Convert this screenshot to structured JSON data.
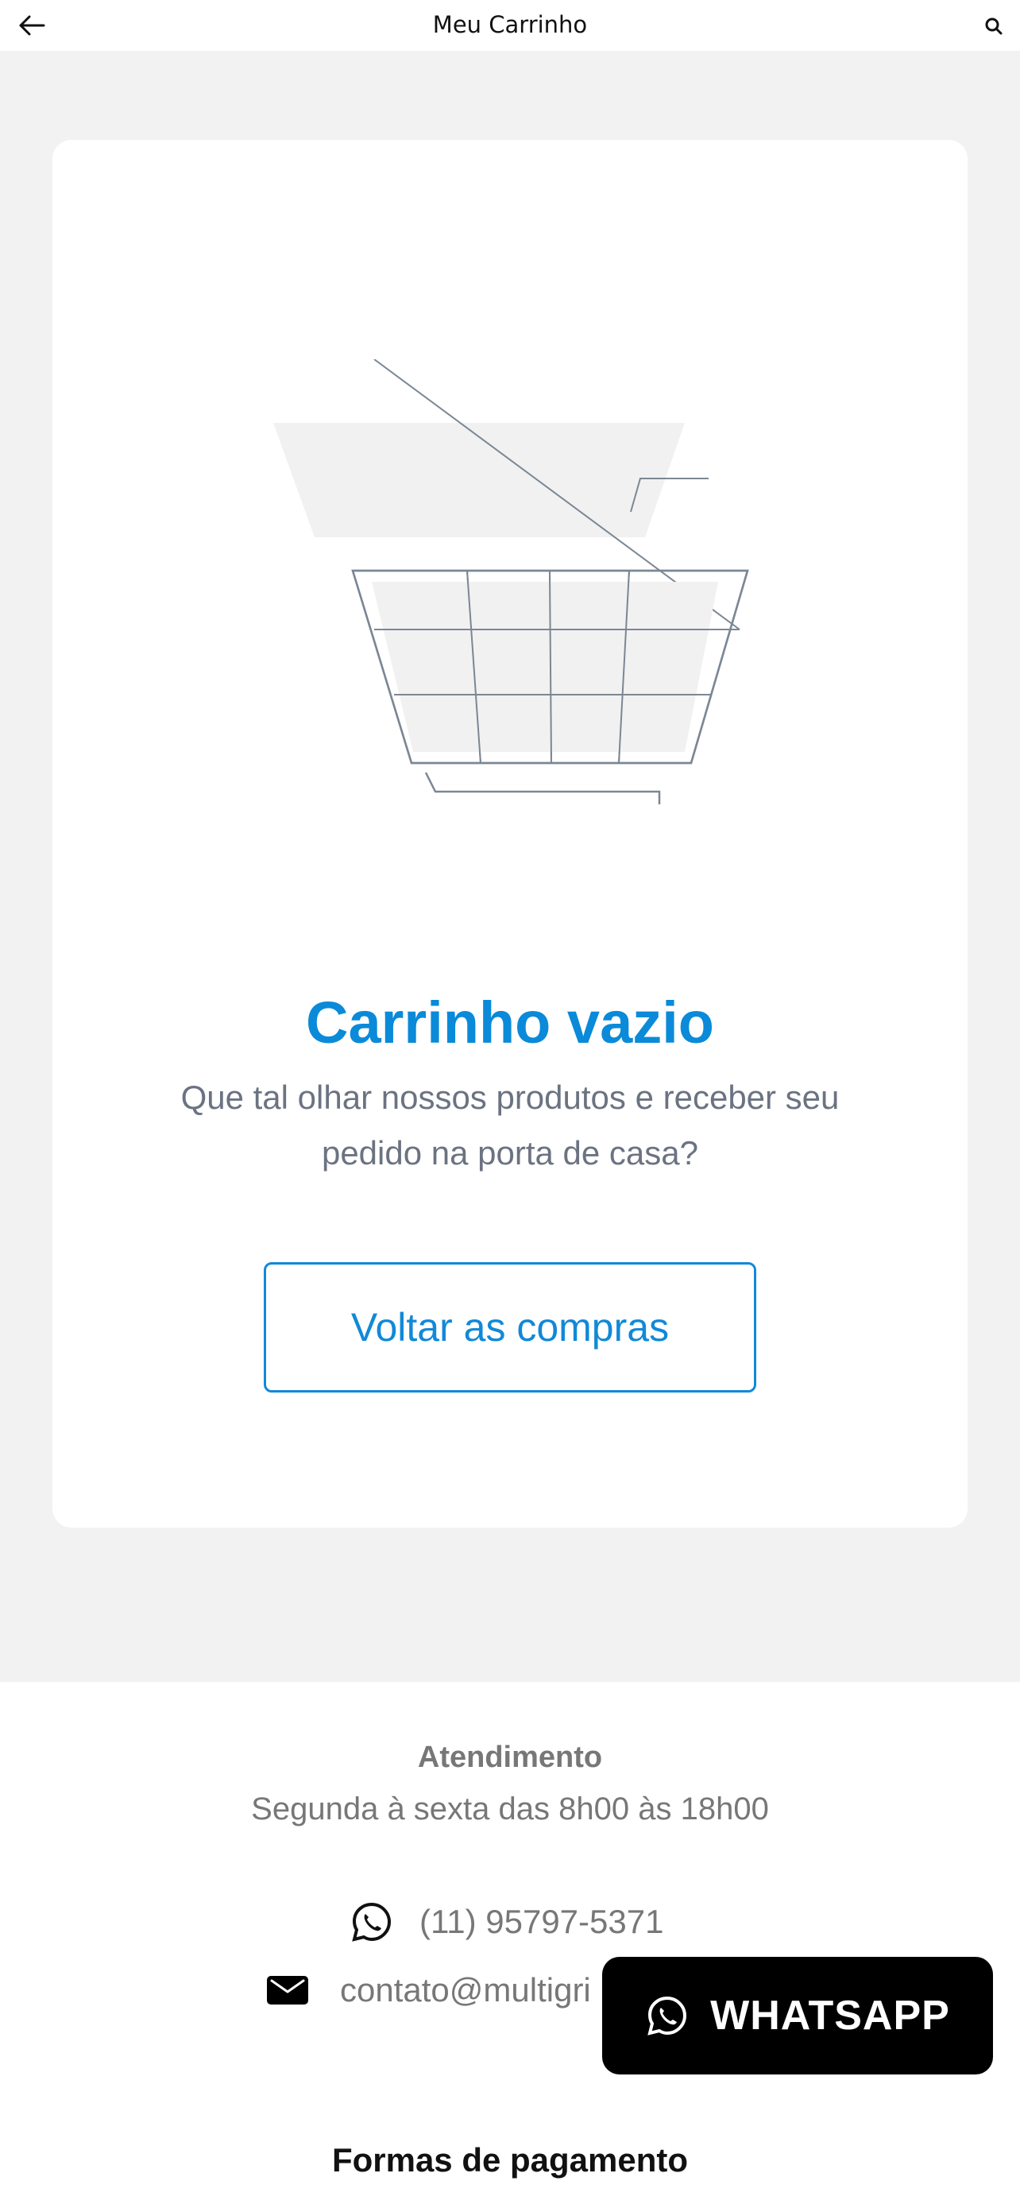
{
  "header": {
    "title": "Meu Carrinho",
    "back_icon": "arrow-left-icon",
    "search_icon": "search-icon"
  },
  "empty_cart": {
    "illustration": "empty-cart-illustration",
    "title": "Carrinho vazio",
    "subtitle": "Que tal olhar nossos produtos e receber seu pedido na porta de casa?",
    "button_label": "Voltar as compras"
  },
  "footer": {
    "attendance_title": "Atendimento",
    "attendance_hours": "Segunda à sexta das 8h00 às 18h00",
    "phone": "(11) 95797-5371",
    "email": "contato@multigri",
    "payment_title": "Formas de pagamento"
  },
  "whatsapp_button": {
    "label": "WHATSAPP",
    "icon": "whatsapp-icon"
  },
  "colors": {
    "accent": "#0a8ad9",
    "background": "#f2f2f2",
    "text_muted": "#6b7382",
    "cart_stroke": "#7b8794",
    "cart_dark": "#13294b"
  }
}
